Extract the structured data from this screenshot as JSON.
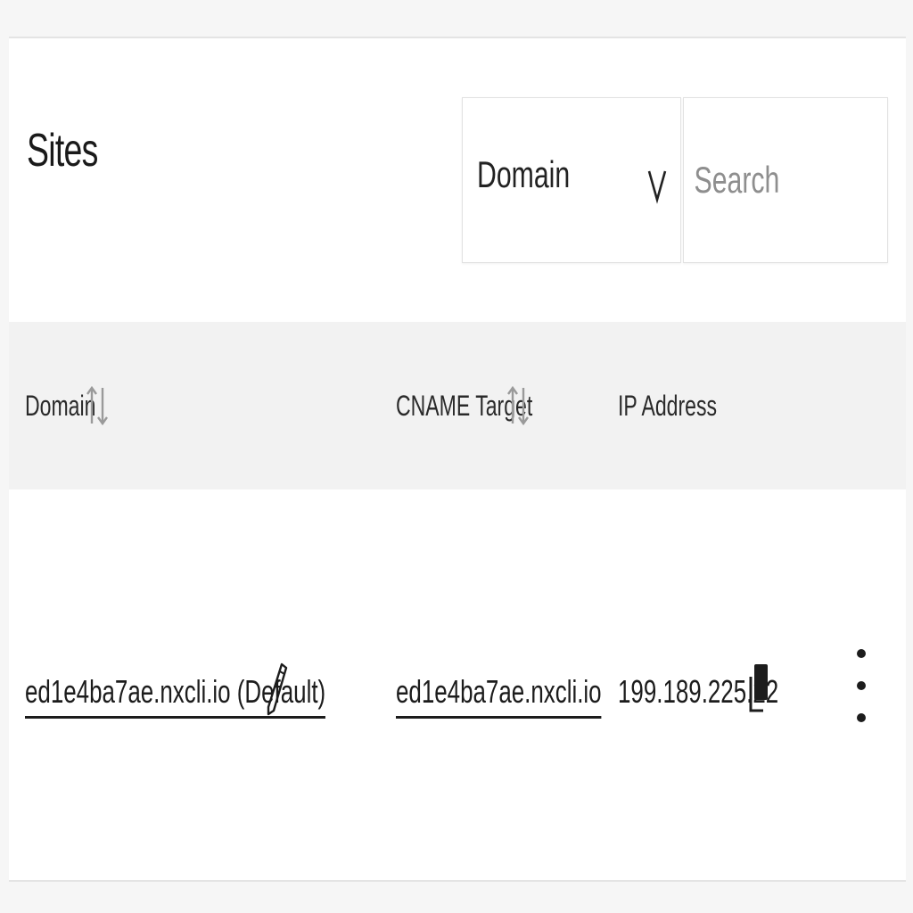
{
  "header": {
    "title": "Sites"
  },
  "filter": {
    "selected": "Domain",
    "chevron_icon": "chevron-down-icon"
  },
  "search": {
    "placeholder": "Search",
    "value": ""
  },
  "table": {
    "columns": [
      {
        "label": "Domain",
        "sortable": true
      },
      {
        "label": "CNAME Target",
        "sortable": true
      },
      {
        "label": "IP Address",
        "sortable": false
      }
    ],
    "rows": [
      {
        "domain": "ed1e4ba7ae.nxcli.io (Default)",
        "cname": "ed1e4ba7ae.nxcli.io",
        "ip": "199.189.225.22"
      }
    ]
  },
  "icons": {
    "sort": "sort-icon",
    "edit": "pencil-icon",
    "copy": "copy-icon",
    "menu": "kebab-menu-icon"
  },
  "colors": {
    "text": "#1c1c1c",
    "muted": "#8e8e8e",
    "header_bg": "#f2f2f2"
  }
}
